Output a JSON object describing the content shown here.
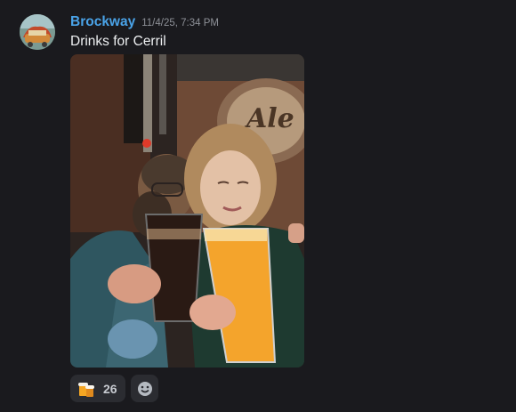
{
  "message": {
    "author": "Brockway",
    "author_color": "#4aa3e8",
    "timestamp": "11/4/25, 7:34 PM",
    "content": "Drinks for Cerril",
    "attachment": {
      "kind": "photo",
      "sign_text": "Ale"
    },
    "reactions": [
      {
        "emoji": "beers-icon",
        "count": "26"
      }
    ],
    "add_reaction_icon": "smiley-add-icon"
  }
}
